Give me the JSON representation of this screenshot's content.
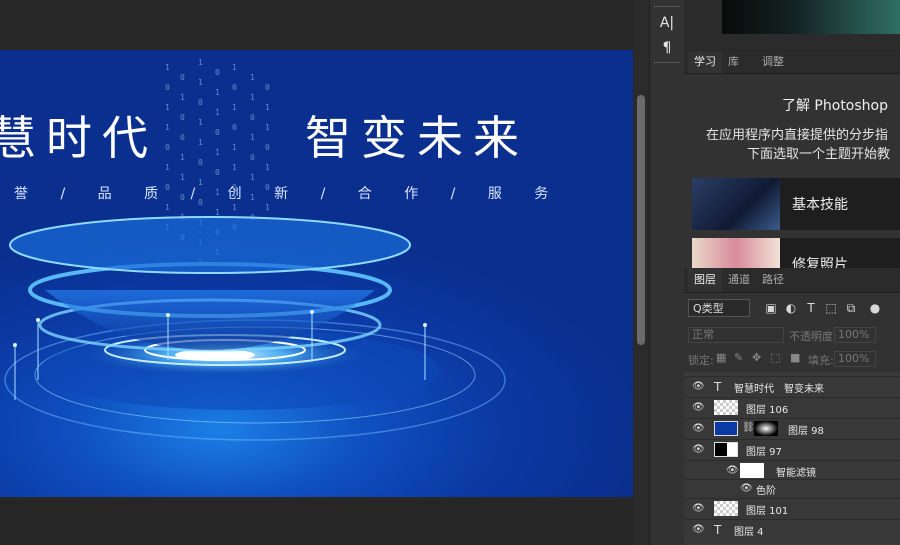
{
  "artwork": {
    "title_left": "慧时代",
    "title_right": "智变未来",
    "subtitle": "誉 / 品 质 / 创 新 / 合 作 / 服 务"
  },
  "toolstrip": {
    "tools": [
      "A|",
      "¶"
    ]
  },
  "learn_panel": {
    "tabs": [
      "学习",
      "库",
      "调整"
    ],
    "heading": "了解 Photoshop",
    "line1": "在应用程序内直接提供的分步指",
    "line2": "下面选取一个主题开始教",
    "cards": [
      {
        "label": "基本技能"
      },
      {
        "label": "修复照片"
      }
    ]
  },
  "layers_panel": {
    "tabs": [
      "图层",
      "通道",
      "路径"
    ],
    "kind_filter": "Q类型",
    "blend_mode": "正常",
    "opacity_label": "不透明度:",
    "opacity_value": "100%",
    "lock_label": "锁定:",
    "fill_label": "填充:",
    "fill_value": "100%",
    "layers": [
      {
        "name": "智慧时代　智变未来",
        "kind": "text"
      },
      {
        "name": "图层 106",
        "kind": "pixel"
      },
      {
        "name": "图层 98",
        "kind": "masked"
      },
      {
        "name": "图层 97",
        "kind": "smart"
      },
      {
        "name": "智能滤镜",
        "kind": "filter"
      },
      {
        "name": "色阶",
        "kind": "filter-item"
      },
      {
        "name": "图层 101",
        "kind": "smart"
      },
      {
        "name": "图层 4",
        "kind": "text"
      }
    ]
  },
  "colors": {
    "accent_blue": "#0b3aa4",
    "panel_bg": "#323232"
  }
}
